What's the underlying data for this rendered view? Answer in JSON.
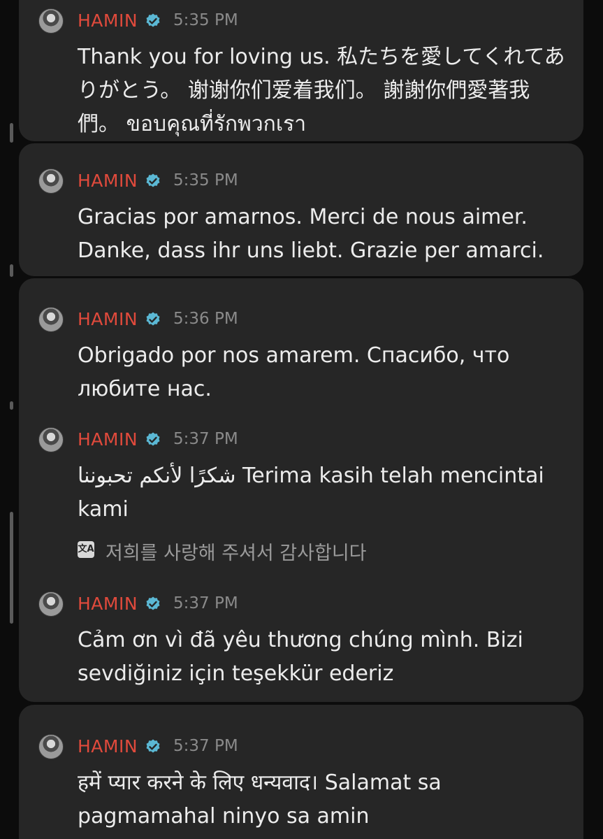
{
  "theme": {
    "background": "#0c0c0c",
    "card": "#262626",
    "username_color": "#e04a3c",
    "verified_color": "#5bb8d4",
    "text_color": "#ececec",
    "meta_color": "#8a8a8a"
  },
  "messages": [
    {
      "username": "HAMIN",
      "time": "5:35 PM",
      "avatar_icon": "profile-avatar",
      "verified_icon": "verified-badge-icon",
      "text": "Thank you for loving us. 私たちを愛してくれてありがとう。 谢谢你们爱着我们。 謝謝你們愛著我們。 ขอบคุณที่รักพวกเรา"
    },
    {
      "username": "HAMIN",
      "time": "5:35 PM",
      "avatar_icon": "profile-avatar",
      "verified_icon": "verified-badge-icon",
      "text": "Gracias por amarnos. Merci de nous aimer. Danke, dass ihr uns liebt. Grazie per amarci."
    },
    {
      "username": "HAMIN",
      "time": "5:36 PM",
      "avatar_icon": "profile-avatar",
      "verified_icon": "verified-badge-icon",
      "text": "Obrigado por nos amarem. Спасибо, что любите нас."
    },
    {
      "username": "HAMIN",
      "time": "5:37 PM",
      "avatar_icon": "profile-avatar",
      "verified_icon": "verified-badge-icon",
      "text": "شكرًا لأنكم تحبوننا Terima kasih telah mencintai kami",
      "translation_icon": "translate-icon",
      "translation": "저희를 사랑해 주셔서 감사합니다"
    },
    {
      "username": "HAMIN",
      "time": "5:37 PM",
      "avatar_icon": "profile-avatar",
      "verified_icon": "verified-badge-icon",
      "text": "Cảm ơn vì đã yêu thương chúng mình. Bizi sevdiğiniz için teşekkür ederiz"
    },
    {
      "username": "HAMIN",
      "time": "5:37 PM",
      "avatar_icon": "profile-avatar",
      "verified_icon": "verified-badge-icon",
      "text": "हमें प्यार करने के लिए धन्यवाद। Salamat sa pagmamahal ninyo sa amin"
    }
  ]
}
